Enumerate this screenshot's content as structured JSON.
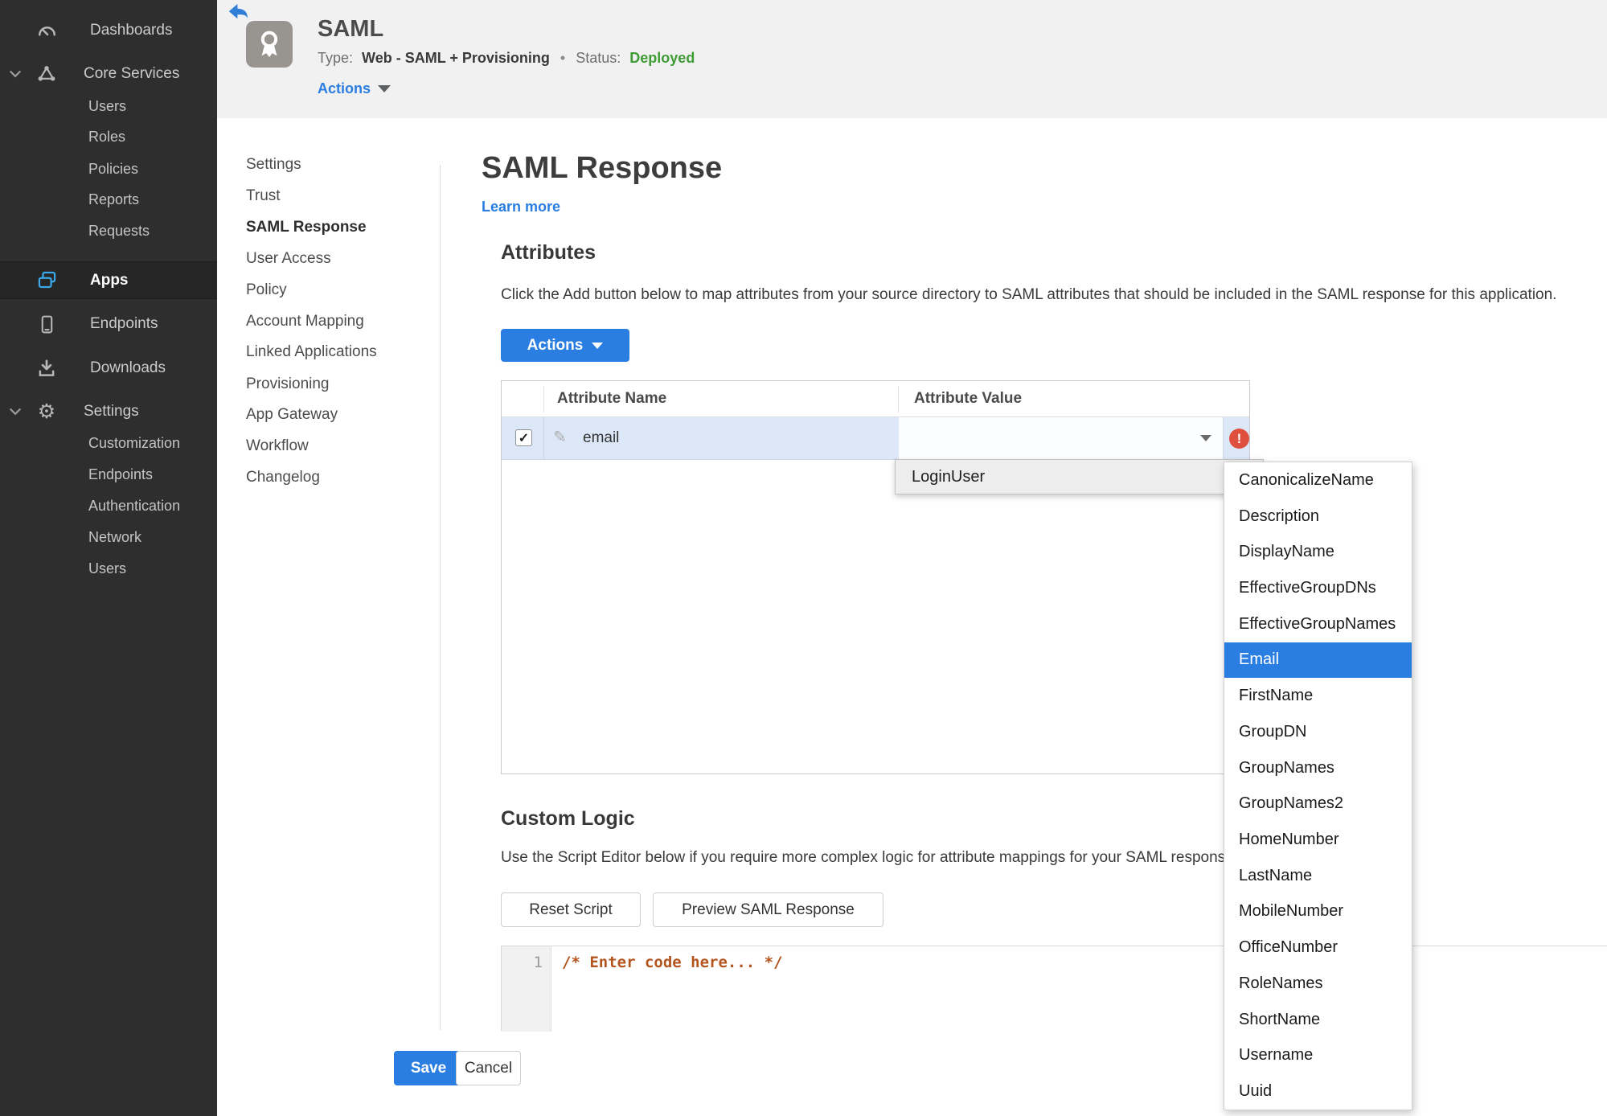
{
  "colors": {
    "accent": "#2a7de1",
    "status_green": "#3f9c35",
    "error_red": "#df4f3d",
    "app_blue": "#3aa7e8"
  },
  "icons": {
    "gear": "⚙",
    "check": "✓",
    "pencil": "✎",
    "error": "!"
  },
  "sidebar": {
    "dashboards": "Dashboards",
    "core_services": "Core Services",
    "core_children": [
      "Users",
      "Roles",
      "Policies",
      "Reports",
      "Requests"
    ],
    "apps": "Apps",
    "endpoints": "Endpoints",
    "downloads": "Downloads",
    "settings": "Settings",
    "settings_children": [
      "Customization",
      "Endpoints",
      "Authentication",
      "Network",
      "Users"
    ]
  },
  "header": {
    "title": "SAML",
    "type_label": "Type:",
    "type_value": "Web - SAML + Provisioning",
    "separator": "•",
    "status_label": "Status:",
    "status_value": "Deployed",
    "actions_label": "Actions"
  },
  "subnav": {
    "items": [
      "Settings",
      "Trust",
      "SAML Response",
      "User Access",
      "Policy",
      "Account Mapping",
      "Linked Applications",
      "Provisioning",
      "App Gateway",
      "Workflow",
      "Changelog"
    ],
    "active": "SAML Response"
  },
  "page": {
    "title": "SAML Response",
    "learn_more": "Learn more"
  },
  "attributes": {
    "heading": "Attributes",
    "description": "Click the Add button below to map attributes from your source directory to SAML attributes that should be included in the SAML response for this application.",
    "actions_button": "Actions",
    "columns": [
      "Attribute Name",
      "Attribute Value"
    ],
    "row": {
      "name": "email",
      "checked": true
    }
  },
  "value_menu": {
    "parent": "LoginUser",
    "selected": "Email",
    "items": [
      "CanonicalizeName",
      "Description",
      "DisplayName",
      "EffectiveGroupDNs",
      "EffectiveGroupNames",
      "Email",
      "FirstName",
      "GroupDN",
      "GroupNames",
      "GroupNames2",
      "HomeNumber",
      "LastName",
      "MobileNumber",
      "OfficeNumber",
      "RoleNames",
      "ShortName",
      "Username",
      "Uuid"
    ]
  },
  "custom_logic": {
    "heading": "Custom Logic",
    "description": "Use the Script Editor below if you require more complex logic for attribute mappings for your SAML response.",
    "reset_button": "Reset Script",
    "preview_button": "Preview SAML Response",
    "line_number": "1",
    "code": "/* Enter code here... */"
  },
  "footer": {
    "save": "Save",
    "cancel": "Cancel"
  }
}
